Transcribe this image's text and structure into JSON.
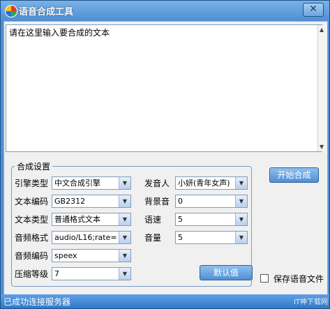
{
  "window": {
    "title": "语音合成工具",
    "close_label": "✕"
  },
  "editor": {
    "text": "请在这里输入要合成的文本"
  },
  "settings": {
    "group_title": "合成设置",
    "engine_type": {
      "label": "引擎类型",
      "value": "中文合成引擎"
    },
    "text_encoding": {
      "label": "文本编码",
      "value": "GB2312"
    },
    "text_type": {
      "label": "文本类型",
      "value": "普通格式文本"
    },
    "audio_format": {
      "label": "音频格式",
      "value": "audio/L16;rate="
    },
    "audio_encoding": {
      "label": "音频编码",
      "value": "speex"
    },
    "compression_level": {
      "label": "压缩等级",
      "value": "7"
    },
    "speaker": {
      "label": "发音人",
      "value": "小妍(青年女声)"
    },
    "background_sound": {
      "label": "背景音",
      "value": "0"
    },
    "speed": {
      "label": "语速",
      "value": "5"
    },
    "volume": {
      "label": "音量",
      "value": "5"
    },
    "default_button": "默认值"
  },
  "actions": {
    "start_button": "开始合成",
    "save_audio_label": "保存语音文件",
    "save_audio_checked": false
  },
  "status": {
    "text": "已成功连接服务器",
    "watermark": "IT神下载网"
  },
  "icons": {
    "dropdown": "chevron-down-icon",
    "scroll_up": "arrow-up-icon",
    "scroll_down": "arrow-down-icon"
  }
}
